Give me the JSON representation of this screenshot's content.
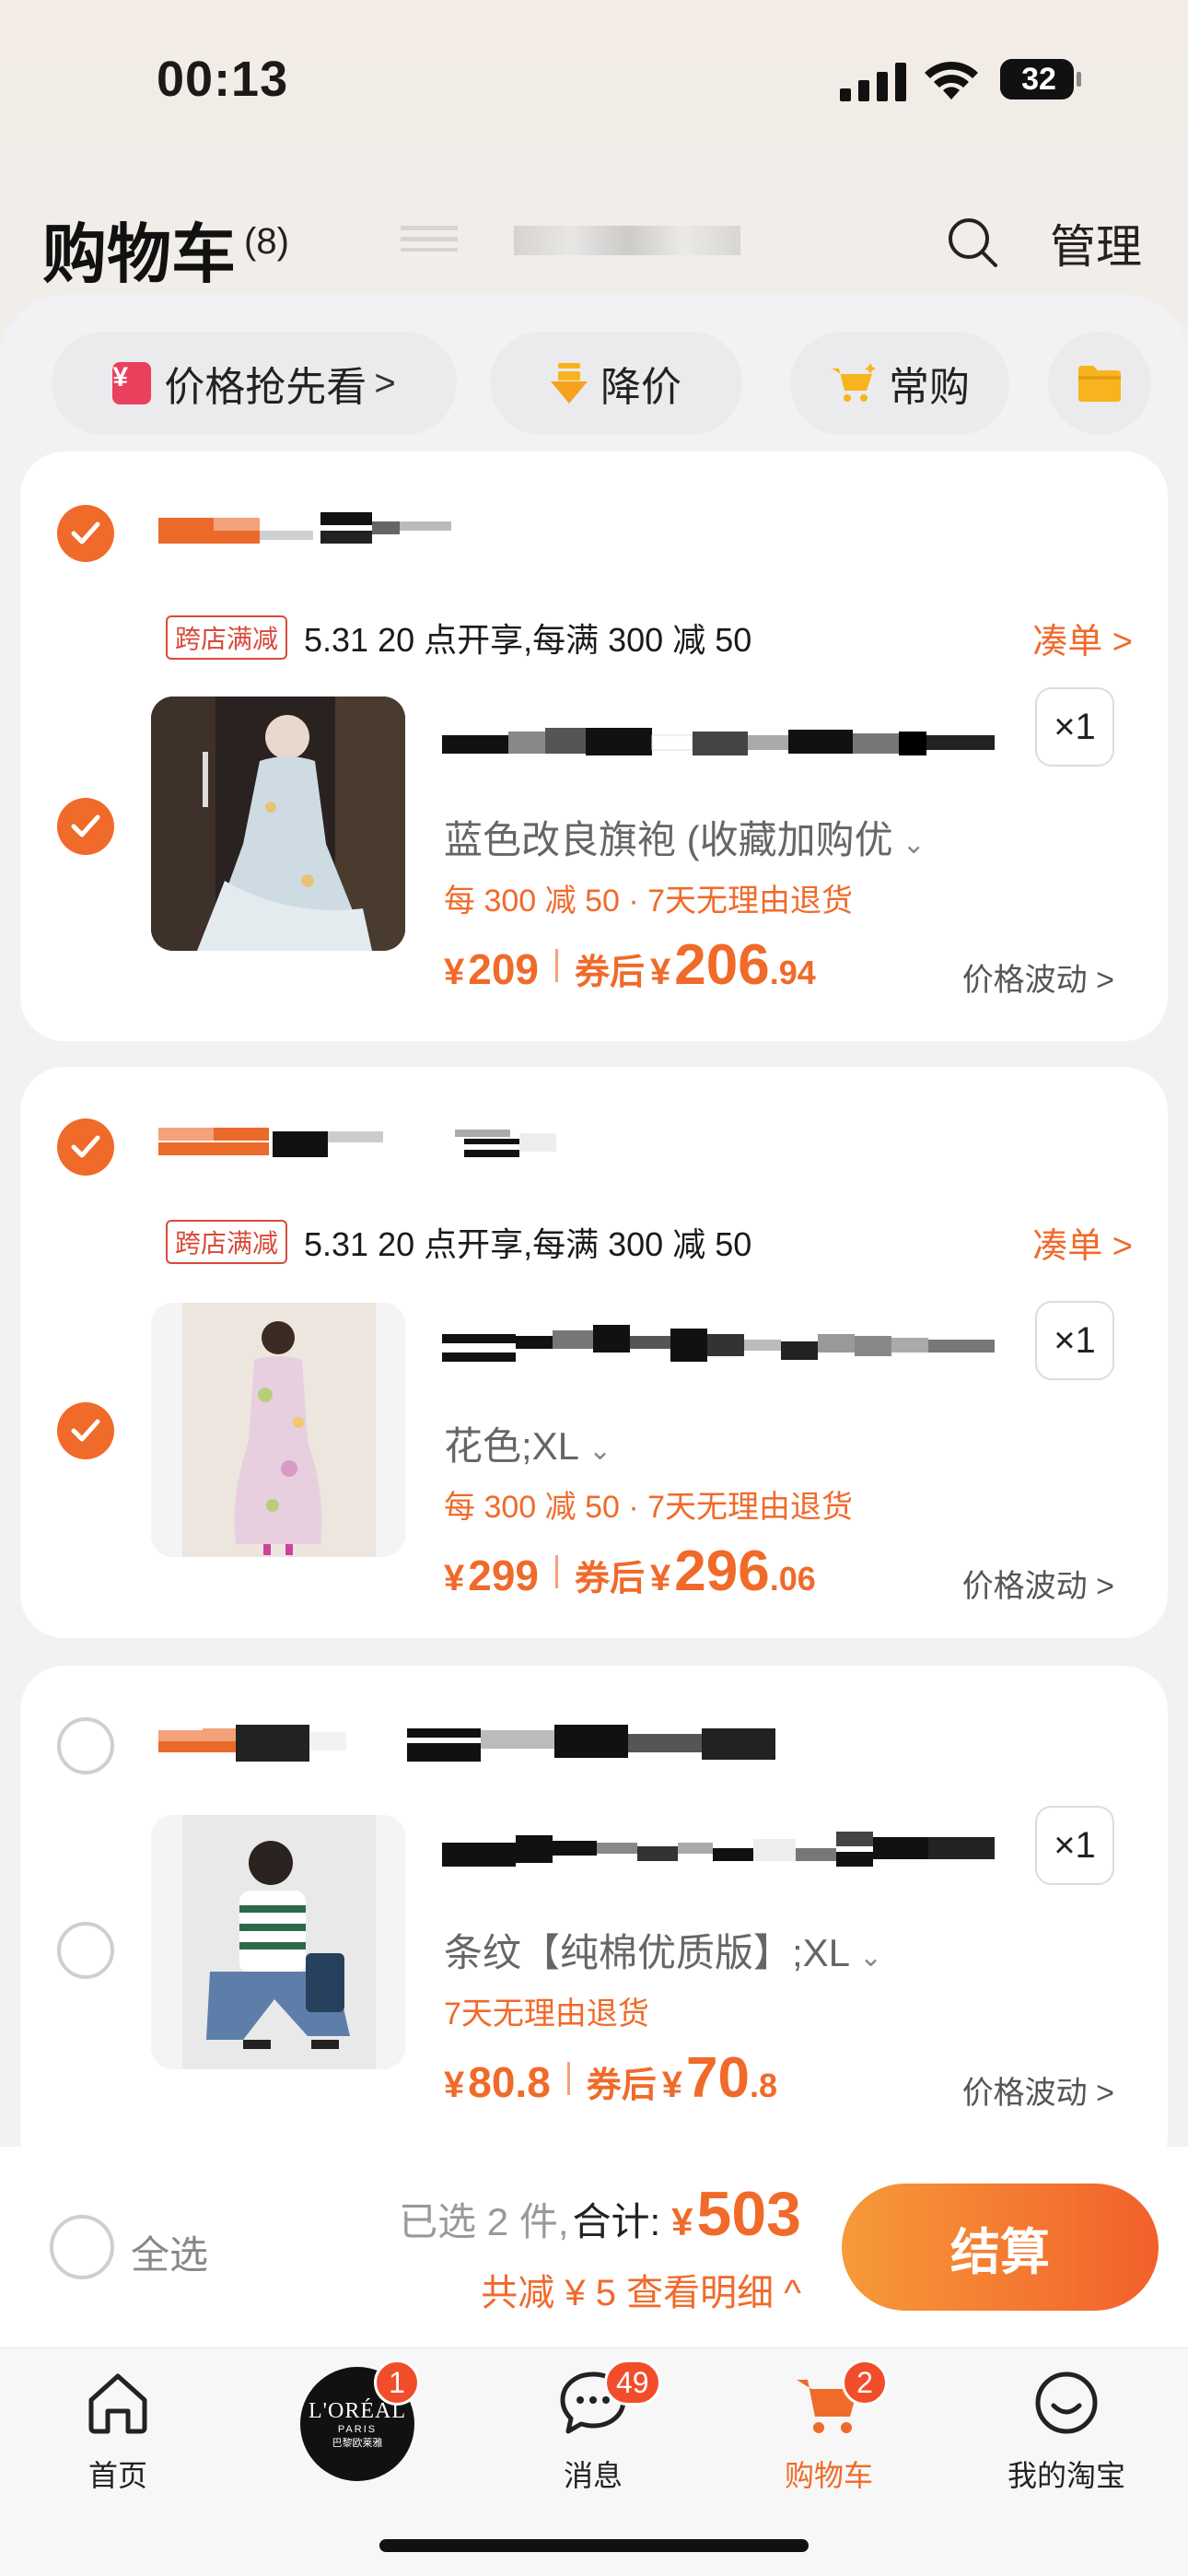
{
  "status_bar": {
    "time": "00:13",
    "battery": "32"
  },
  "header": {
    "title": "购物车",
    "count": "(8)",
    "manage_label": "管理"
  },
  "filters": {
    "price_first": "价格抢先看",
    "price_first_chevron": ">",
    "price_drop": "降价",
    "frequent": "常购",
    "yen_symbol": "¥"
  },
  "stores": [
    {
      "checked": true,
      "promo_tag": "跨店满减",
      "promo_text": "5.31 20 点开享,每满 300 减 50",
      "collect_label": "凑单 >",
      "item": {
        "checked": true,
        "qty": "×1",
        "sku": "蓝色改良旗袍 (收藏加购优",
        "service": "每 300 减 50 · 7天无理由退货",
        "yen": "¥",
        "price": "209",
        "after_label": "券后",
        "after_yen": "¥",
        "after_int": "206",
        "after_dec": ".94",
        "fluct": "价格波动 >"
      }
    },
    {
      "checked": true,
      "promo_tag": "跨店满减",
      "promo_text": "5.31 20 点开享,每满 300 减 50",
      "collect_label": "凑单 >",
      "item": {
        "checked": true,
        "qty": "×1",
        "sku": "花色;XL",
        "service": "每 300 减 50 · 7天无理由退货",
        "yen": "¥",
        "price": "299",
        "after_label": "券后",
        "after_yen": "¥",
        "after_int": "296",
        "after_dec": ".06",
        "fluct": "价格波动 >"
      }
    },
    {
      "checked": false,
      "item": {
        "checked": false,
        "qty": "×1",
        "sku": "条纹【纯棉优质版】;XL",
        "service": "7天无理由退货",
        "yen": "¥",
        "price": "80.8",
        "after_label": "券后",
        "after_yen": "¥",
        "after_int": "70",
        "after_dec": ".8",
        "fluct": "价格波动 >"
      }
    }
  ],
  "checkout": {
    "select_all_label": "全选",
    "selected_text": "已选 2 件,",
    "total_label": "合计:",
    "yen": "¥",
    "total_amount": "503",
    "discount_text": "共减 ¥ 5  查看明细 ^",
    "button_label": "结算"
  },
  "tabs": [
    {
      "label": "首页",
      "icon": "home-icon"
    },
    {
      "label": "",
      "icon": "loreal-ad-icon",
      "badge": "1",
      "logo_text": "L'ORÉAL",
      "logo_sub": "PARIS",
      "logo_cn": "巴黎欧莱雅"
    },
    {
      "label": "消息",
      "icon": "message-icon",
      "badge": "49"
    },
    {
      "label": "购物车",
      "icon": "cart-icon",
      "badge": "2",
      "active": true
    },
    {
      "label": "我的淘宝",
      "icon": "profile-icon"
    }
  ],
  "colors": {
    "accent": "#f06a2a",
    "promo_red": "#d84a3a",
    "badge_red": "#f24d2b"
  }
}
